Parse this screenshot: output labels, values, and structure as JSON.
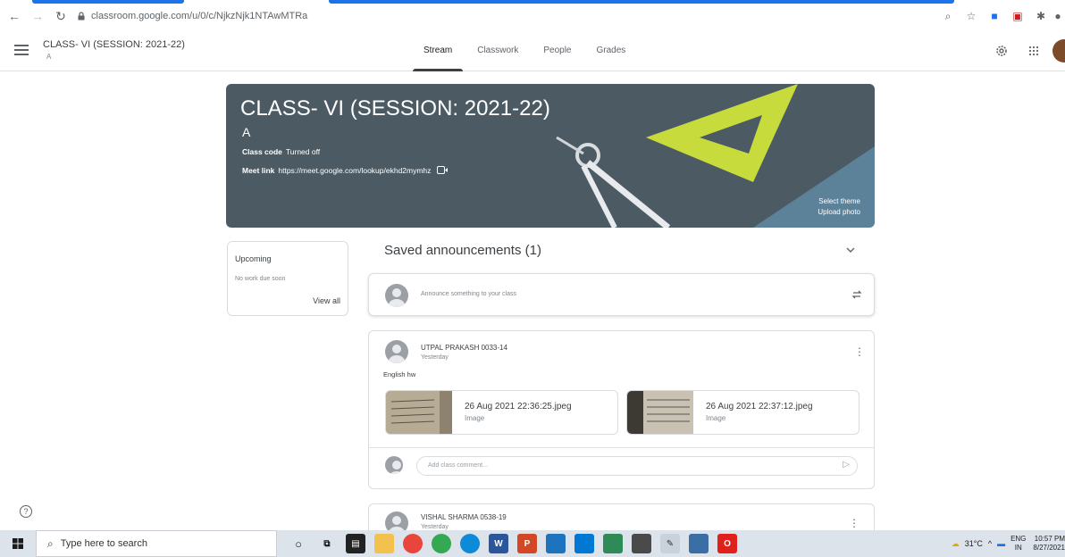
{
  "browser": {
    "url": "classroom.google.com/u/0/c/NjkzNjk1NTAwMTRa"
  },
  "header": {
    "class_title": "CLASS- VI (SESSION: 2021-22)",
    "section": "A",
    "tabs": [
      {
        "label": "Stream",
        "active": true
      },
      {
        "label": "Classwork",
        "active": false
      },
      {
        "label": "People",
        "active": false
      },
      {
        "label": "Grades",
        "active": false
      }
    ]
  },
  "banner": {
    "title": "CLASS- VI (SESSION: 2021-22)",
    "section": "A",
    "class_code_label": "Class code",
    "class_code_value": "Turned off",
    "meet_label": "Meet link",
    "meet_value": "https://meet.google.com/lookup/ekhd2mymhz",
    "select_theme": "Select theme",
    "upload_photo": "Upload photo",
    "bg_color": "#4c5b63"
  },
  "upcoming": {
    "title": "Upcoming",
    "empty": "No work due soon",
    "view_all": "View all"
  },
  "stream": {
    "saved_label": "Saved announcements (1)",
    "announce_placeholder": "Announce something to your class",
    "posts": [
      {
        "author": "UTPAL PRAKASH 0033-14",
        "time": "Yesterday",
        "body": "English hw",
        "attachments": [
          {
            "name": "26 Aug 2021 22:36:25.jpeg",
            "type": "Image"
          },
          {
            "name": "26 Aug 2021 22:37:12.jpeg",
            "type": "Image"
          }
        ],
        "comment_placeholder": "Add class comment..."
      },
      {
        "author": "VISHAL SHARMA 0538-19",
        "time": "Yesterday"
      }
    ]
  },
  "taskbar": {
    "search_placeholder": "Type here to search",
    "weather": "31°C",
    "lang": "ENG",
    "region": "IN",
    "time": "10:57 PM",
    "date": "8/27/2021"
  }
}
